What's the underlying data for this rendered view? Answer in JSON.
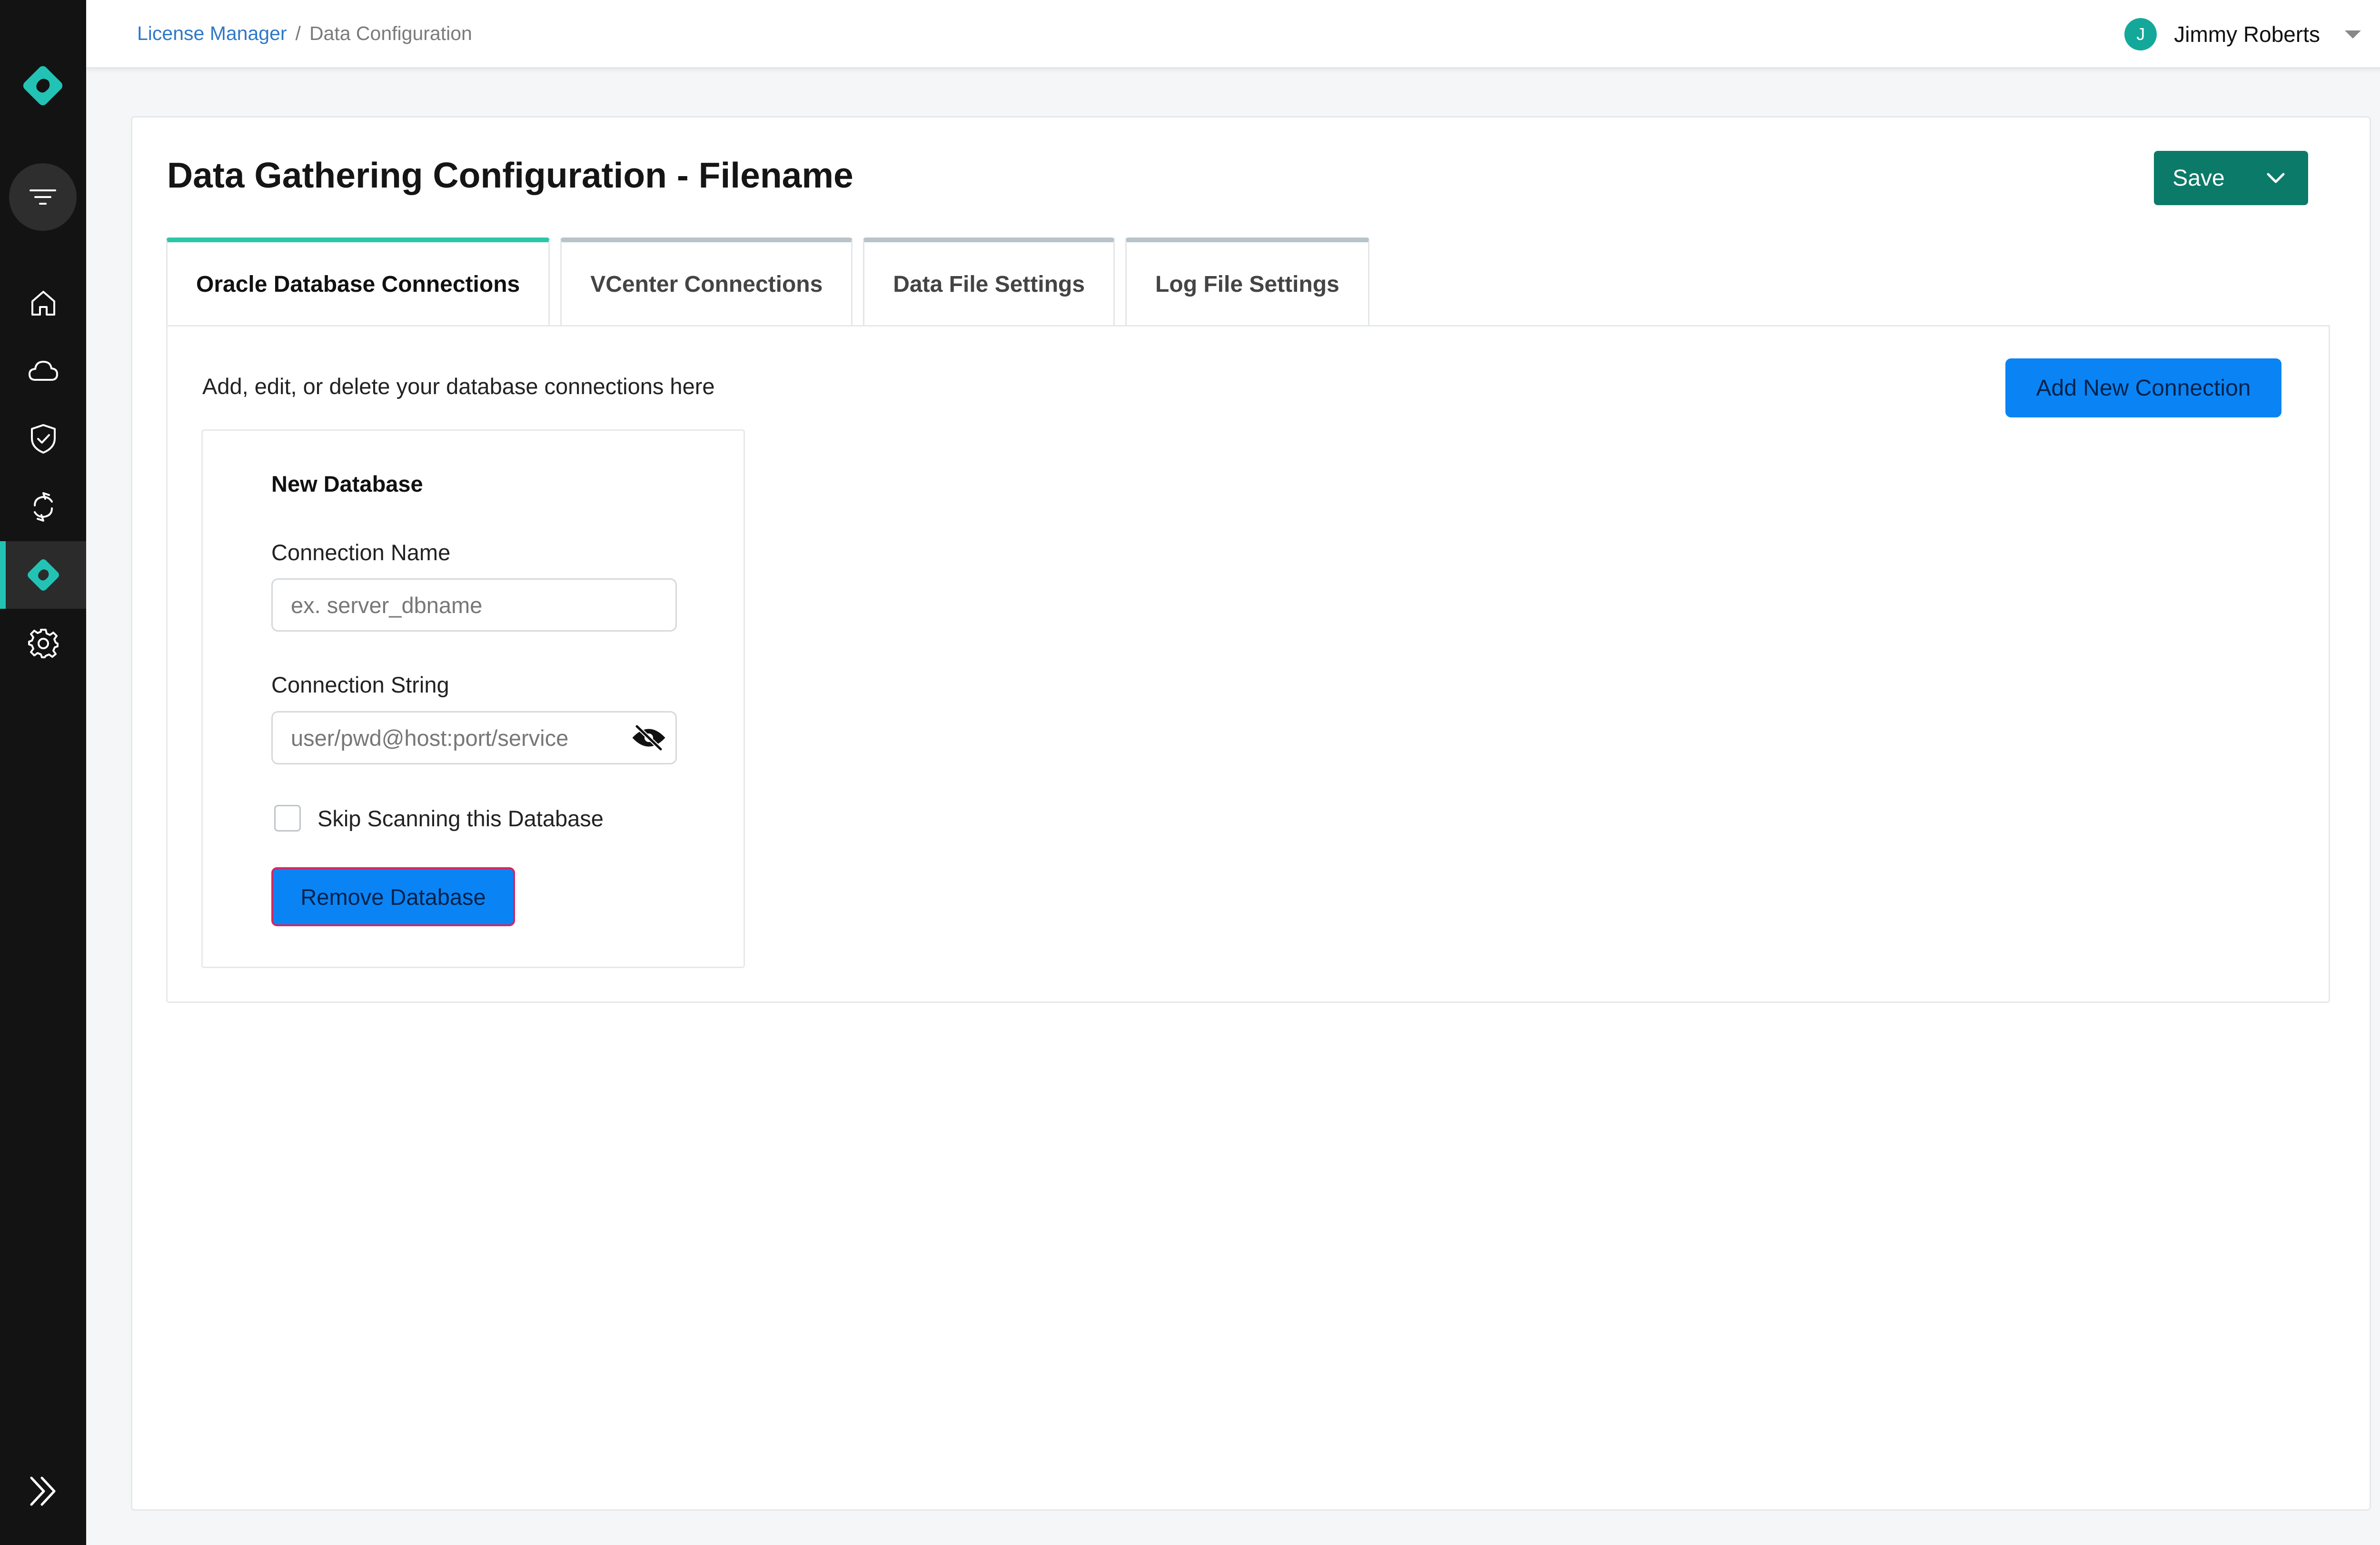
{
  "breadcrumb": {
    "parent": "License Manager",
    "separator": "/",
    "current": "Data Configuration"
  },
  "user": {
    "initial": "J",
    "name": "Jimmy Roberts"
  },
  "page": {
    "title": "Data Gathering Configuration - Filename",
    "save_label": "Save"
  },
  "tabs": [
    {
      "label": "Oracle Database Connections",
      "active": true
    },
    {
      "label": "VCenter Connections",
      "active": false
    },
    {
      "label": "Data File Settings",
      "active": false
    },
    {
      "label": "Log File Settings",
      "active": false
    }
  ],
  "panel": {
    "description": "Add, edit, or delete your database connections here",
    "add_button": "Add New Connection"
  },
  "db_card": {
    "title": "New Database",
    "name_label": "Connection Name",
    "name_placeholder": "ex. server_dbname",
    "string_label": "Connection String",
    "string_placeholder": "user/pwd@host:port/service",
    "skip_label": "Skip Scanning this Database",
    "remove_button": "Remove Database"
  },
  "colors": {
    "sidebar_bg": "#131313",
    "accent_teal": "#22c3b4",
    "save_green": "#0c7a68",
    "primary_blue": "#0a84f5",
    "link_blue": "#2f78c8"
  },
  "icons": {
    "sidebar": [
      "app-logo-icon",
      "filter-icon",
      "home-icon",
      "cloud-icon",
      "shield-check-icon",
      "sync-icon",
      "license-icon",
      "gear-icon",
      "expand-icon"
    ]
  }
}
